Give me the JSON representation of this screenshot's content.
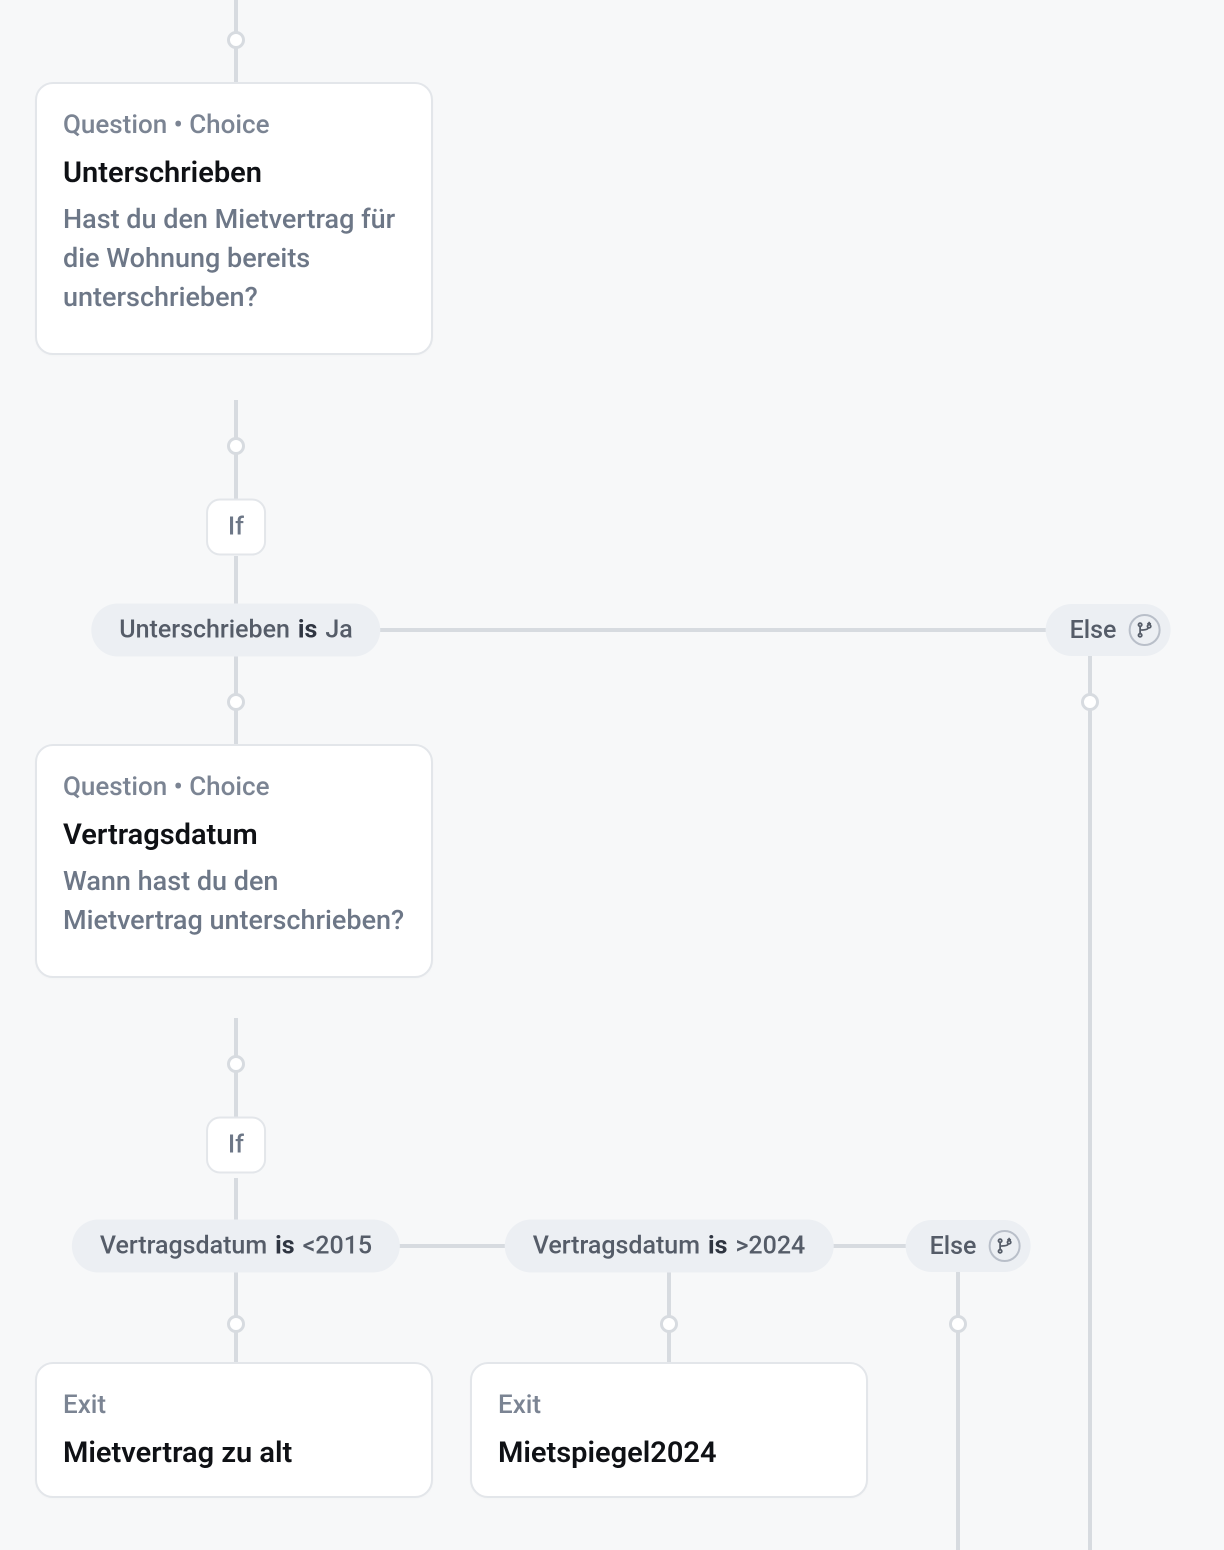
{
  "cards": {
    "q1": {
      "eyebrow": "Question • Choice",
      "title": "Unterschrieben",
      "desc": "Hast du den Mietvertrag für die Wohnung bereits unterschrieben?"
    },
    "q2": {
      "eyebrow": "Question • Choice",
      "title": "Vertragsdatum",
      "desc": "Wann hast du den Mietvertrag unterschrieben?"
    },
    "e1": {
      "eyebrow": "Exit",
      "title": "Mietvertrag zu alt"
    },
    "e2": {
      "eyebrow": "Exit",
      "title": "Mietspiegel2024"
    }
  },
  "labels": {
    "if": "If",
    "else": "Else"
  },
  "conditions": {
    "c1": {
      "field": "Unterschrieben",
      "op": "is",
      "value": "Ja"
    },
    "c2": {
      "field": "Vertragsdatum",
      "op": "is",
      "value": "<2015"
    },
    "c3": {
      "field": "Vertragsdatum",
      "op": "is",
      "value": ">2024"
    }
  }
}
